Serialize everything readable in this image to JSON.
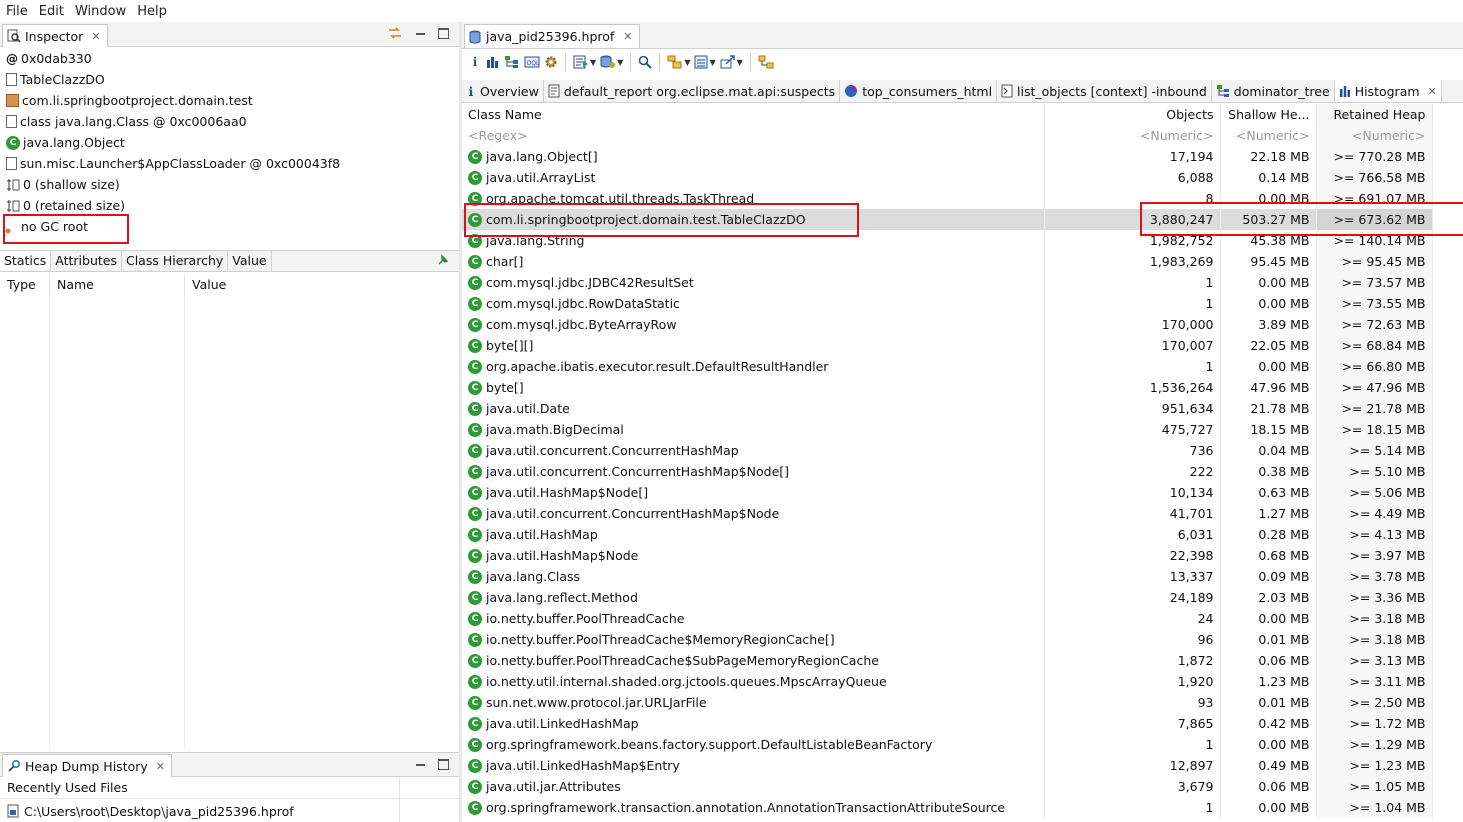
{
  "menu": {
    "file": "File",
    "edit": "Edit",
    "window": "Window",
    "help": "Help"
  },
  "inspector": {
    "tab_title": "Inspector",
    "rows": [
      {
        "icon": "at-icon",
        "text": "0x0dab330"
      },
      {
        "icon": "class-file-icon",
        "text": "TableClazzDO"
      },
      {
        "icon": "package-icon",
        "text": "com.li.springbootproject.domain.test"
      },
      {
        "icon": "class-file-icon",
        "text": "class java.lang.Class @ 0xc0006aa0"
      },
      {
        "icon": "class-icon",
        "text": "java.lang.Object"
      },
      {
        "icon": "class-file-icon",
        "text": "sun.misc.Launcher$AppClassLoader @ 0xc00043f8"
      },
      {
        "icon": "size-icon",
        "text": "0 (shallow size)"
      },
      {
        "icon": "size-icon",
        "text": "0 (retained size)"
      },
      {
        "icon": "gc-root-icon",
        "text": "no GC root"
      }
    ],
    "tabs": [
      "Statics",
      "Attributes",
      "Class Hierarchy",
      "Value"
    ],
    "field_columns": [
      "Type",
      "Name",
      "Value"
    ]
  },
  "heap_history": {
    "tab_title": "Heap Dump History",
    "header": "Recently Used Files",
    "file": "C:\\Users\\root\\Desktop\\java_pid25396.hprof"
  },
  "editor": {
    "tab_title": "java_pid25396.hprof",
    "subtabs": [
      {
        "label": "Overview",
        "icon": "info-icon"
      },
      {
        "label": "default_report  org.eclipse.mat.api:suspects",
        "icon": "report-icon"
      },
      {
        "label": "top_consumers_html",
        "icon": "pie-chart-icon"
      },
      {
        "label": "list_objects  [context] -inbound",
        "icon": "list-icon"
      },
      {
        "label": "dominator_tree",
        "icon": "tree-icon"
      },
      {
        "label": "Histogram",
        "icon": "histogram-icon"
      }
    ],
    "columns": {
      "class_name": "Class Name",
      "objects": "Objects",
      "shallow": "Shallow He...",
      "retained": "Retained Heap"
    },
    "filters": {
      "class_name": "<Regex>",
      "objects": "<Numeric>",
      "shallow": "<Numeric>",
      "retained": "<Numeric>"
    },
    "rows": [
      {
        "name": "java.lang.Object[]",
        "objects": "17,194",
        "shallow": "22.18 MB",
        "retained": ">= 770.28 MB"
      },
      {
        "name": "java.util.ArrayList",
        "objects": "6,088",
        "shallow": "0.14 MB",
        "retained": ">= 766.58 MB"
      },
      {
        "name": "org.apache.tomcat.util.threads.TaskThread",
        "objects": "8",
        "shallow": "0.00 MB",
        "retained": ">= 691.07 MB"
      },
      {
        "name": "com.li.springbootproject.domain.test.TableClazzDO",
        "objects": "3,880,247",
        "shallow": "503.27 MB",
        "retained": ">= 673.62 MB"
      },
      {
        "name": "java.lang.String",
        "objects": "1,982,752",
        "shallow": "45.38 MB",
        "retained": ">= 140.14 MB"
      },
      {
        "name": "char[]",
        "objects": "1,983,269",
        "shallow": "95.45 MB",
        "retained": ">= 95.45 MB"
      },
      {
        "name": "com.mysql.jdbc.JDBC42ResultSet",
        "objects": "1",
        "shallow": "0.00 MB",
        "retained": ">= 73.57 MB"
      },
      {
        "name": "com.mysql.jdbc.RowDataStatic",
        "objects": "1",
        "shallow": "0.00 MB",
        "retained": ">= 73.55 MB"
      },
      {
        "name": "com.mysql.jdbc.ByteArrayRow",
        "objects": "170,000",
        "shallow": "3.89 MB",
        "retained": ">= 72.63 MB"
      },
      {
        "name": "byte[][]",
        "objects": "170,007",
        "shallow": "22.05 MB",
        "retained": ">= 68.84 MB"
      },
      {
        "name": "org.apache.ibatis.executor.result.DefaultResultHandler",
        "objects": "1",
        "shallow": "0.00 MB",
        "retained": ">= 66.80 MB"
      },
      {
        "name": "byte[]",
        "objects": "1,536,264",
        "shallow": "47.96 MB",
        "retained": ">= 47.96 MB"
      },
      {
        "name": "java.util.Date",
        "objects": "951,634",
        "shallow": "21.78 MB",
        "retained": ">= 21.78 MB"
      },
      {
        "name": "java.math.BigDecimal",
        "objects": "475,727",
        "shallow": "18.15 MB",
        "retained": ">= 18.15 MB"
      },
      {
        "name": "java.util.concurrent.ConcurrentHashMap",
        "objects": "736",
        "shallow": "0.04 MB",
        "retained": ">= 5.14 MB"
      },
      {
        "name": "java.util.concurrent.ConcurrentHashMap$Node[]",
        "objects": "222",
        "shallow": "0.38 MB",
        "retained": ">= 5.10 MB"
      },
      {
        "name": "java.util.HashMap$Node[]",
        "objects": "10,134",
        "shallow": "0.63 MB",
        "retained": ">= 5.06 MB"
      },
      {
        "name": "java.util.concurrent.ConcurrentHashMap$Node",
        "objects": "41,701",
        "shallow": "1.27 MB",
        "retained": ">= 4.49 MB"
      },
      {
        "name": "java.util.HashMap",
        "objects": "6,031",
        "shallow": "0.28 MB",
        "retained": ">= 4.13 MB"
      },
      {
        "name": "java.util.HashMap$Node",
        "objects": "22,398",
        "shallow": "0.68 MB",
        "retained": ">= 3.97 MB"
      },
      {
        "name": "java.lang.Class",
        "objects": "13,337",
        "shallow": "0.09 MB",
        "retained": ">= 3.78 MB"
      },
      {
        "name": "java.lang.reflect.Method",
        "objects": "24,189",
        "shallow": "2.03 MB",
        "retained": ">= 3.36 MB"
      },
      {
        "name": "io.netty.buffer.PoolThreadCache",
        "objects": "24",
        "shallow": "0.00 MB",
        "retained": ">= 3.18 MB"
      },
      {
        "name": "io.netty.buffer.PoolThreadCache$MemoryRegionCache[]",
        "objects": "96",
        "shallow": "0.01 MB",
        "retained": ">= 3.18 MB"
      },
      {
        "name": "io.netty.buffer.PoolThreadCache$SubPageMemoryRegionCache",
        "objects": "1,872",
        "shallow": "0.06 MB",
        "retained": ">= 3.13 MB"
      },
      {
        "name": "io.netty.util.internal.shaded.org.jctools.queues.MpscArrayQueue",
        "objects": "1,920",
        "shallow": "1.23 MB",
        "retained": ">= 3.11 MB"
      },
      {
        "name": "sun.net.www.protocol.jar.URLJarFile",
        "objects": "93",
        "shallow": "0.01 MB",
        "retained": ">= 2.50 MB"
      },
      {
        "name": "java.util.LinkedHashMap",
        "objects": "7,865",
        "shallow": "0.42 MB",
        "retained": ">= 1.72 MB"
      },
      {
        "name": "org.springframework.beans.factory.support.DefaultListableBeanFactory",
        "objects": "1",
        "shallow": "0.00 MB",
        "retained": ">= 1.29 MB"
      },
      {
        "name": "java.util.LinkedHashMap$Entry",
        "objects": "12,897",
        "shallow": "0.49 MB",
        "retained": ">= 1.23 MB"
      },
      {
        "name": "java.util.jar.Attributes",
        "objects": "3,679",
        "shallow": "0.06 MB",
        "retained": ">= 1.05 MB"
      },
      {
        "name": "org.springframework.transaction.annotation.AnnotationTransactionAttributeSource",
        "objects": "1",
        "shallow": "0.00 MB",
        "retained": ">= 1.04 MB"
      }
    ]
  },
  "colors": {
    "highlight": "#d9121a",
    "class_icon": "#2e9a3a",
    "selected_row": "#dcdcdc"
  }
}
